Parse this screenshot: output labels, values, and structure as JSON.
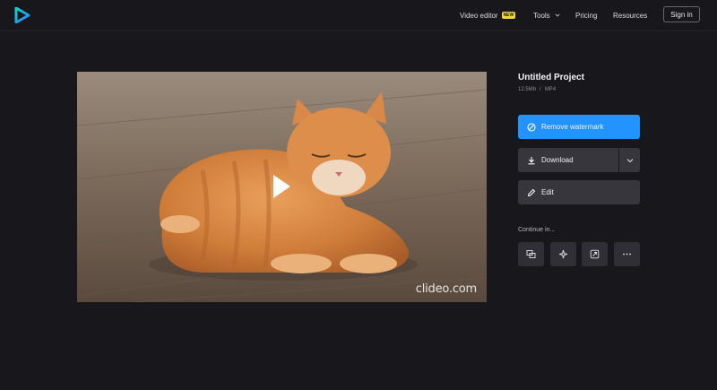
{
  "header": {
    "nav": {
      "video_editor": "Video editor",
      "badge_new": "NEW",
      "tools": "Tools",
      "pricing": "Pricing",
      "resources": "Resources"
    },
    "sign_in": "Sign in",
    "logo_icon": "clideo-play-logo-icon"
  },
  "video": {
    "watermark": "clideo.com",
    "play_icon": "play-icon"
  },
  "project": {
    "title": "Untitled Project",
    "size": "12.5Mb",
    "separator": "/",
    "format": "MP4"
  },
  "actions": {
    "remove_watermark": "Remove watermark",
    "download": "Download",
    "edit": "Edit"
  },
  "continue": {
    "label": "Continue in...",
    "tools": [
      "merge-icon",
      "sparkle-icon",
      "resize-icon",
      "more-icon"
    ]
  },
  "colors": {
    "background": "#18181c",
    "accent": "#2393ff",
    "button_dark": "#36363c",
    "badge": "#f3d63a"
  }
}
